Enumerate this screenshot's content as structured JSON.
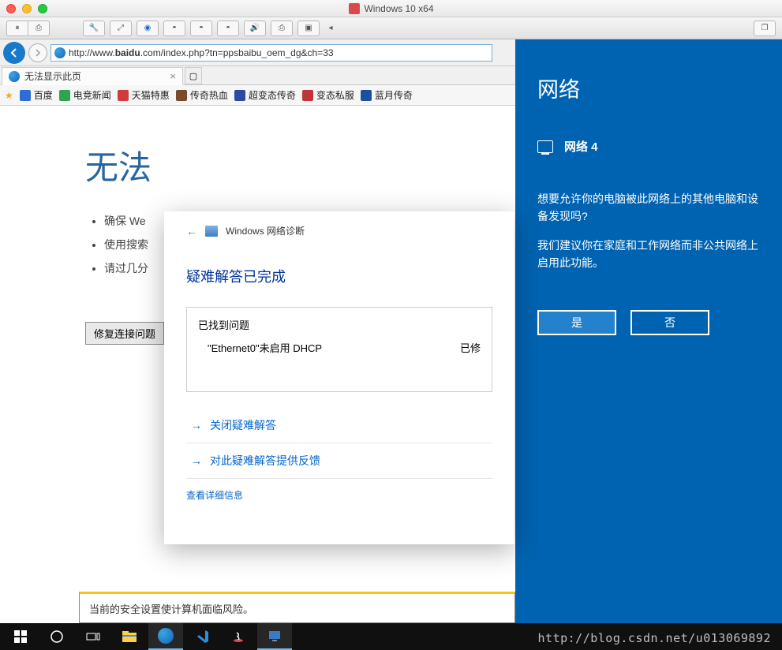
{
  "mac": {
    "title": "Windows 10 x64"
  },
  "ie": {
    "url_prefix": "http://www.",
    "url_domain": "baidu",
    "url_suffix": ".com/index.php?tn=ppsbaibu_oem_dg&ch=33",
    "tab_title": "无法显示此页",
    "favorites": [
      {
        "label": "百度"
      },
      {
        "label": "电竞新闻"
      },
      {
        "label": "天猫特惠"
      },
      {
        "label": "传奇热血"
      },
      {
        "label": "超变态传奇"
      },
      {
        "label": "变态私服"
      },
      {
        "label": "蓝月传奇"
      }
    ],
    "page_heading": "无法",
    "page_bullets": [
      "确保 We",
      "使用搜索",
      "请过几分"
    ],
    "fix_button": "修复连接问题",
    "security_msg": "当前的安全设置使计算机面临风险。"
  },
  "dialog": {
    "window_title": "Windows 网络诊断",
    "title": "疑难解答已完成",
    "found_label": "已找到问题",
    "issue_text": "\"Ethernet0\"未启用 DHCP",
    "issue_status": "已修",
    "action_close": "关闭疑难解答",
    "action_feedback": "对此疑难解答提供反馈",
    "detail_link": "查看详细信息"
  },
  "network": {
    "heading": "网络",
    "subheading": "网络 4",
    "question": "想要允许你的电脑被此网络上的其他电脑和设备发现吗?",
    "suggestion": "我们建议你在家庭和工作网络而非公共网络上启用此功能。",
    "btn_yes": "是",
    "btn_no": "否"
  },
  "watermark": "http://blog.csdn.net/u013069892"
}
